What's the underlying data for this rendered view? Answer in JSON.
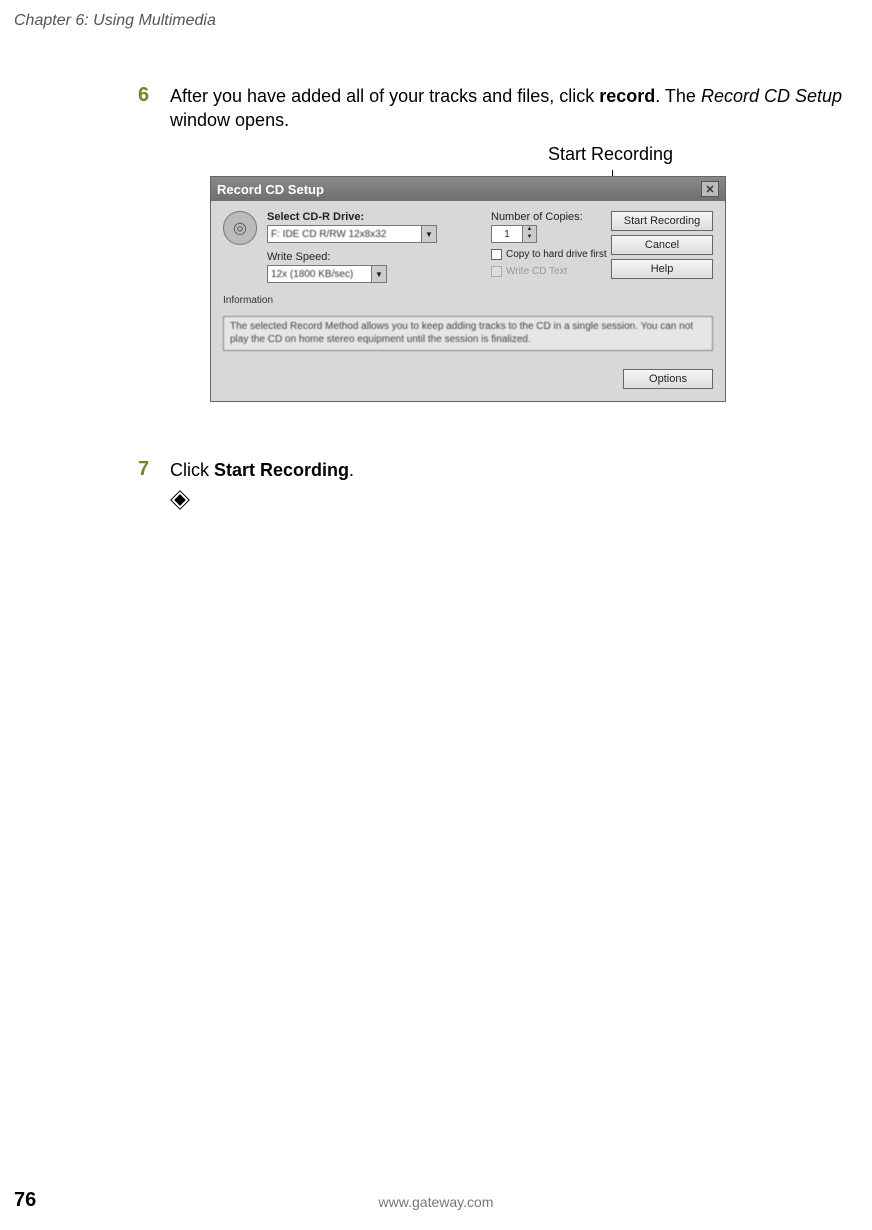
{
  "header": {
    "chapter": "Chapter 6: Using Multimedia"
  },
  "callout": {
    "label": "Start Recording"
  },
  "steps": {
    "s6": {
      "num": "6",
      "pre": "After you have added all of your tracks and files, click ",
      "bold": "record",
      "mid": ". The ",
      "italic": "Record CD Setup",
      "post": " window opens."
    },
    "s7": {
      "num": "7",
      "pre": "Click ",
      "bold": "Start Recording",
      "post": "."
    }
  },
  "dialog": {
    "title": "Record CD Setup",
    "labels": {
      "drive": "Select CD-R Drive:",
      "speed": "Write Speed:",
      "copies": "Number of Copies:",
      "info_heading": "Information"
    },
    "values": {
      "drive": "F: IDE CD R/RW 12x8x32",
      "speed": "12x (1800 KB/sec)",
      "copies": "1"
    },
    "checks": {
      "copy_first": "Copy to hard drive first",
      "cd_text": "Write CD Text"
    },
    "buttons": {
      "start": "Start Recording",
      "cancel": "Cancel",
      "help": "Help",
      "options": "Options"
    },
    "info_text": "The selected Record Method allows you to keep adding tracks to the CD in a single session. You can not play the CD on home stereo equipment until the session is finalized."
  },
  "footer": {
    "page": "76",
    "url": "www.gateway.com"
  }
}
